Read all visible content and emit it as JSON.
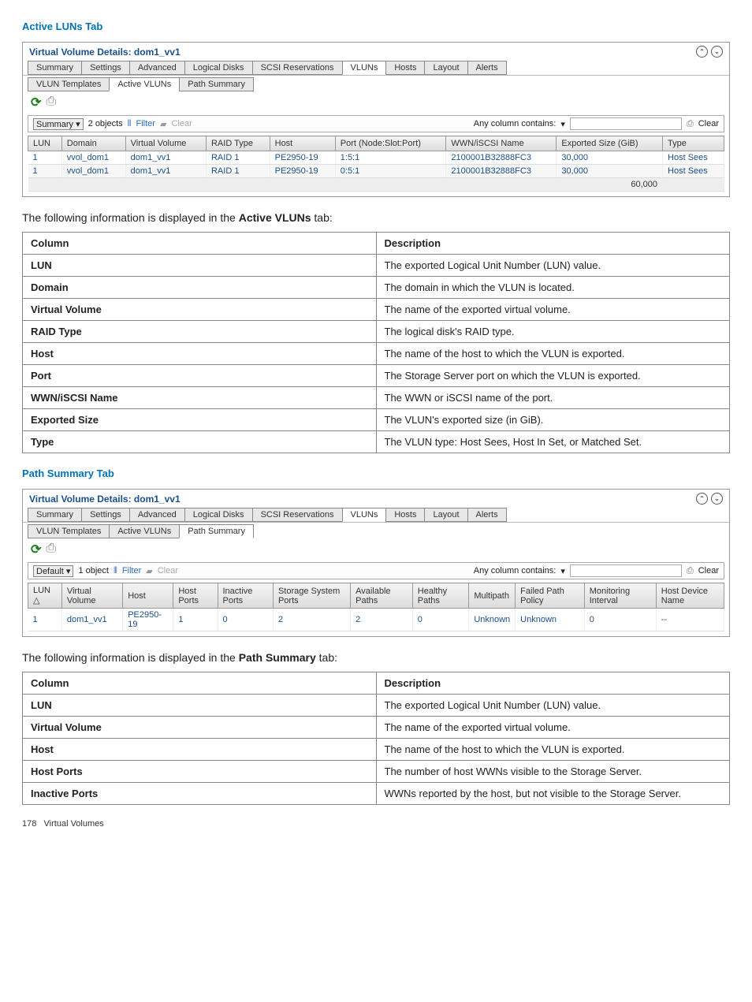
{
  "section1": {
    "title": "Active LUNs Tab",
    "panelTitle": "Virtual Volume Details: dom1_vv1",
    "tabRow1": [
      "Summary",
      "Settings",
      "Advanced",
      "Logical Disks",
      "SCSI Reservations",
      "VLUNs",
      "Hosts",
      "Layout",
      "Alerts"
    ],
    "tabRow1Active": 5,
    "tabRow2": [
      "VLUN Templates",
      "Active VLUNs",
      "Path Summary"
    ],
    "tabRow2Active": 1,
    "filter": {
      "dropdown": "Summary",
      "count": "2 objects",
      "filterLabel": "Filter",
      "clearLabel": "Clear",
      "anyCol": "Any column contains:",
      "rightClear": "Clear"
    },
    "headers": [
      "LUN",
      "Domain",
      "Virtual Volume",
      "RAID Type",
      "Host",
      "Port (Node:Slot:Port)",
      "WWN/iSCSI Name",
      "Exported Size (GiB)",
      "Type"
    ],
    "rows": [
      [
        "1",
        "vvol_dom1",
        "dom1_vv1",
        "RAID 1",
        "PE2950-19",
        "1:5:1",
        "2100001B32888FC3",
        "30,000",
        "Host Sees"
      ],
      [
        "1",
        "vvol_dom1",
        "dom1_vv1",
        "RAID 1",
        "PE2950-19",
        "0:5:1",
        "2100001B32888FC3",
        "30,000",
        "Host Sees"
      ]
    ],
    "footTotal": "60,000"
  },
  "desc1": {
    "intro_pre": "The following information is displayed in the ",
    "intro_bold": "Active VLUNs",
    "intro_post": " tab:",
    "header": [
      "Column",
      "Description"
    ],
    "rows": [
      [
        "LUN",
        "The exported Logical Unit Number (LUN) value."
      ],
      [
        "Domain",
        "The domain in which the VLUN is located."
      ],
      [
        "Virtual Volume",
        "The name of the exported virtual volume."
      ],
      [
        "RAID Type",
        "The logical disk's RAID type."
      ],
      [
        "Host",
        "The name of the host to which the VLUN is exported."
      ],
      [
        "Port",
        "The Storage Server port on which the VLUN is exported."
      ],
      [
        "WWN/iSCSI Name",
        "The WWN or iSCSI name of the port."
      ],
      [
        "Exported Size",
        "The VLUN's exported size (in GiB)."
      ],
      [
        "Type",
        "The VLUN type: Host Sees, Host In Set, or Matched Set."
      ]
    ]
  },
  "section2": {
    "title": "Path Summary Tab",
    "panelTitle": "Virtual Volume Details: dom1_vv1",
    "tabRow1": [
      "Summary",
      "Settings",
      "Advanced",
      "Logical Disks",
      "SCSI Reservations",
      "VLUNs",
      "Hosts",
      "Layout",
      "Alerts"
    ],
    "tabRow1Active": 5,
    "tabRow2": [
      "VLUN Templates",
      "Active VLUNs",
      "Path Summary"
    ],
    "tabRow2Active": 2,
    "filter": {
      "dropdown": "Default",
      "count": "1 object",
      "filterLabel": "Filter",
      "clearLabel": "Clear",
      "anyCol": "Any column contains:",
      "rightClear": "Clear"
    },
    "headers": [
      "LUN △",
      "Virtual Volume",
      "Host",
      "Host Ports",
      "Inactive Ports",
      "Storage System Ports",
      "Available Paths",
      "Healthy Paths",
      "Multipath",
      "Failed Path Policy",
      "Monitoring Interval",
      "Host Device Name"
    ],
    "rows": [
      [
        "1",
        "dom1_vv1",
        "PE2950-19",
        "1",
        "0",
        "2",
        "2",
        "0",
        "Unknown",
        "Unknown",
        "0",
        "--"
      ]
    ]
  },
  "desc2": {
    "intro_pre": "The following information is displayed in the ",
    "intro_bold": "Path Summary",
    "intro_post": " tab:",
    "header": [
      "Column",
      "Description"
    ],
    "rows": [
      [
        "LUN",
        "The exported Logical Unit Number (LUN) value."
      ],
      [
        "Virtual Volume",
        "The name of the exported virtual volume."
      ],
      [
        "Host",
        "The name of the host to which the VLUN is exported."
      ],
      [
        "Host Ports",
        "The number of host WWNs visible to the Storage Server."
      ],
      [
        "Inactive Ports",
        "WWNs reported by the host, but not visible to the Storage Server."
      ]
    ]
  },
  "footer": {
    "page": "178",
    "label": "Virtual Volumes"
  }
}
